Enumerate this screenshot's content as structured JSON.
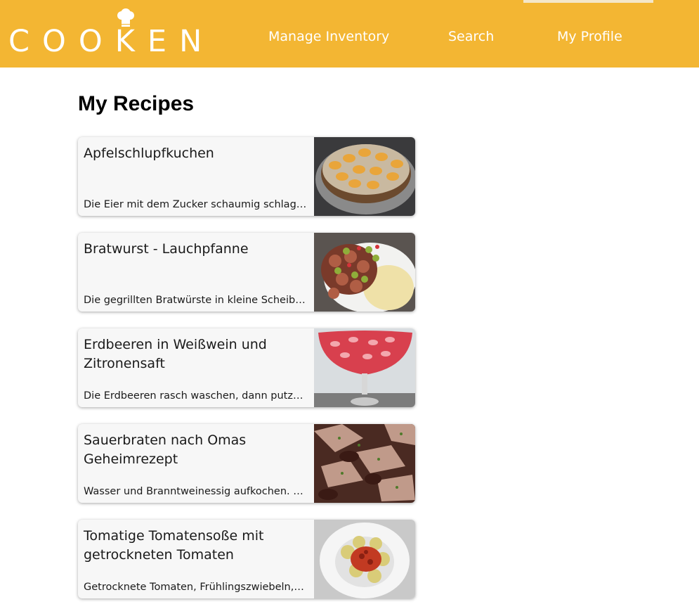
{
  "app": {
    "logo_text": "COOKEN"
  },
  "nav": {
    "items": [
      {
        "label": "Manage Inventory"
      },
      {
        "label": "Search"
      },
      {
        "label": "My Profile"
      }
    ],
    "active": "My Profile"
  },
  "colors": {
    "header": "#f3b633",
    "card_bg": "#f7f7f7"
  },
  "main": {
    "title": "My Recipes",
    "recipes": [
      {
        "title": "Apfelschlupfkuchen",
        "description": "Die Eier mit dem Zucker schaumig schlagen, Vanillezucker und",
        "image_icon": "apple-cake-photo"
      },
      {
        "title": "Bratwurst - Lauchpfanne",
        "description": "Die gegrillten Bratwürste in kleine Scheiben schneiden",
        "image_icon": "bratwurst-photo"
      },
      {
        "title": "Erdbeeren in Weißwein und Zitronensaft",
        "description": "Die Erdbeeren rasch waschen, dann putzen und halbieren",
        "image_icon": "strawberry-wine-photo"
      },
      {
        "title": "Sauerbraten nach Omas Geheimrezept",
        "description": "Wasser und Branntweinessig aufkochen. Zwiebeln schälen",
        "image_icon": "sauerbraten-photo"
      },
      {
        "title": "Tomatige Tomatensoße mit getrockneten Tomaten",
        "description": "Getrocknete Tomaten, Frühlingszwiebeln, Knoblauch hacken",
        "image_icon": "tortellini-tomato-photo"
      }
    ]
  }
}
